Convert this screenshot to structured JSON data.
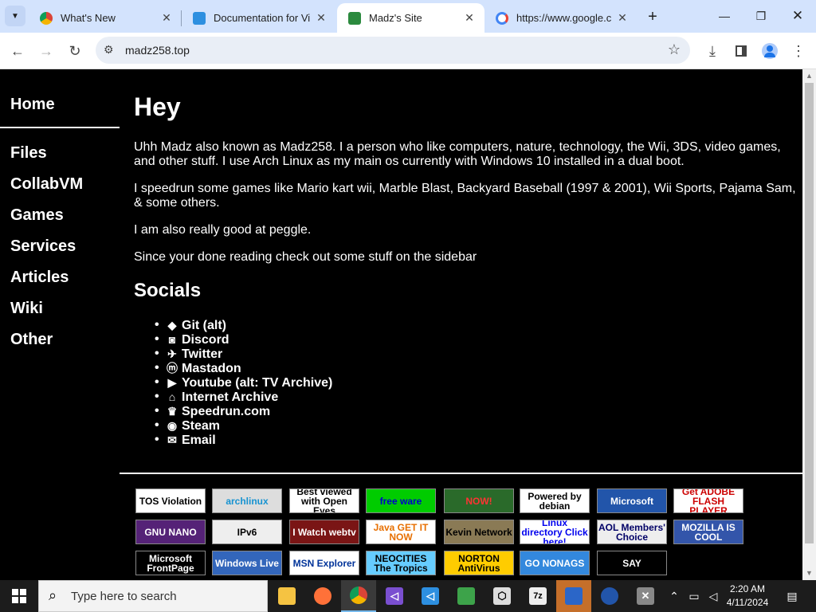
{
  "browser": {
    "tabs": [
      {
        "title": "What's New",
        "favicon": "chrome-icon"
      },
      {
        "title": "Documentation for Vi",
        "favicon": "vscode-icon"
      },
      {
        "title": "Madz's Site",
        "favicon": "site-icon"
      },
      {
        "title": "https://www.google.c",
        "favicon": "google-icon"
      }
    ],
    "address": "madz258.top"
  },
  "sidebar": {
    "items": [
      "Home",
      "Files",
      "CollabVM",
      "Games",
      "Services",
      "Articles",
      "Wiki",
      "Other"
    ]
  },
  "main": {
    "heading": "Hey",
    "paragraphs": [
      "Uhh Madz also known as Madz258. I a person who like computers, nature, technology, the Wii, 3DS, video games, and other stuff. I use Arch Linux as my main os currently with Windows 10 installed in a dual boot.",
      "I speedrun some games like Mario kart wii, Marble Blast, Backyard Baseball (1997 & 2001), Wii Sports, Pajama Sam, & some others.",
      "I am also really good at peggle.",
      "Since your done reading check out some stuff on the sidebar"
    ],
    "socials_heading": "Socials",
    "socials": [
      {
        "label": "Git (alt)",
        "icon": "git-icon"
      },
      {
        "label": "Discord",
        "icon": "discord-icon"
      },
      {
        "label": "Twitter",
        "icon": "twitter-icon"
      },
      {
        "label": "Mastadon",
        "icon": "mastodon-icon"
      },
      {
        "label": "Youtube (alt: TV Archive)",
        "icon": "youtube-icon"
      },
      {
        "label": "Internet Archive",
        "icon": "archive-icon"
      },
      {
        "label": "Speedrun.com",
        "icon": "trophy-icon"
      },
      {
        "label": "Steam",
        "icon": "steam-icon"
      },
      {
        "label": "Email",
        "icon": "envelope-icon"
      }
    ]
  },
  "badges": [
    {
      "text": "TOS Violation",
      "bg": "#ffffff",
      "fg": "#000000"
    },
    {
      "text": "archlinux",
      "bg": "#dddddd",
      "fg": "#1793d1"
    },
    {
      "text": "Best viewed with Open Eyes",
      "bg": "#ffffff",
      "fg": "#000000"
    },
    {
      "text": "free ware",
      "bg": "#00cc00",
      "fg": "#0000cc"
    },
    {
      "text": "NOW!",
      "bg": "#2a6a2a",
      "fg": "#ff3333"
    },
    {
      "text": "Powered by debian",
      "bg": "#ffffff",
      "fg": "#000000"
    },
    {
      "text": "Microsoft",
      "bg": "#2255aa",
      "fg": "#ffffff"
    },
    {
      "text": "Get ADOBE FLASH PLAYER",
      "bg": "#ffffff",
      "fg": "#cc0000"
    },
    {
      "text": "GNU NANO",
      "bg": "#552277",
      "fg": "#ffffff"
    },
    {
      "text": "IPv6",
      "bg": "#eeeeee",
      "fg": "#000000"
    },
    {
      "text": "I Watch webtv",
      "bg": "#7a1515",
      "fg": "#ffffff"
    },
    {
      "text": "Java GET IT NOW",
      "bg": "#ffffff",
      "fg": "#e76f00"
    },
    {
      "text": "Kevin Network",
      "bg": "#8a7a55",
      "fg": "#000000"
    },
    {
      "text": "Linux directory Click here!",
      "bg": "#ffffff",
      "fg": "#0000ee"
    },
    {
      "text": "AOL Members' Choice",
      "bg": "#eeeeee",
      "fg": "#000066"
    },
    {
      "text": "MOZILLA IS COOL",
      "bg": "#3355aa",
      "fg": "#ffffff"
    },
    {
      "text": "Microsoft FrontPage",
      "bg": "#000000",
      "fg": "#ffffff"
    },
    {
      "text": "Windows Live",
      "bg": "#3366bb",
      "fg": "#ffffff"
    },
    {
      "text": "MSN Explorer",
      "bg": "#ffffff",
      "fg": "#003399"
    },
    {
      "text": "NEOCITIES The Tropics",
      "bg": "#66ccff",
      "fg": "#000000"
    },
    {
      "text": "NORTON AntiVirus",
      "bg": "#ffcc00",
      "fg": "#000000"
    },
    {
      "text": "GO NONAGS",
      "bg": "#3388dd",
      "fg": "#ffffff"
    },
    {
      "text": "SAY",
      "bg": "#000000",
      "fg": "#ffffff"
    }
  ],
  "taskbar": {
    "search_placeholder": "Type here to search",
    "time": "2:20 AM",
    "date": "4/11/2024"
  }
}
